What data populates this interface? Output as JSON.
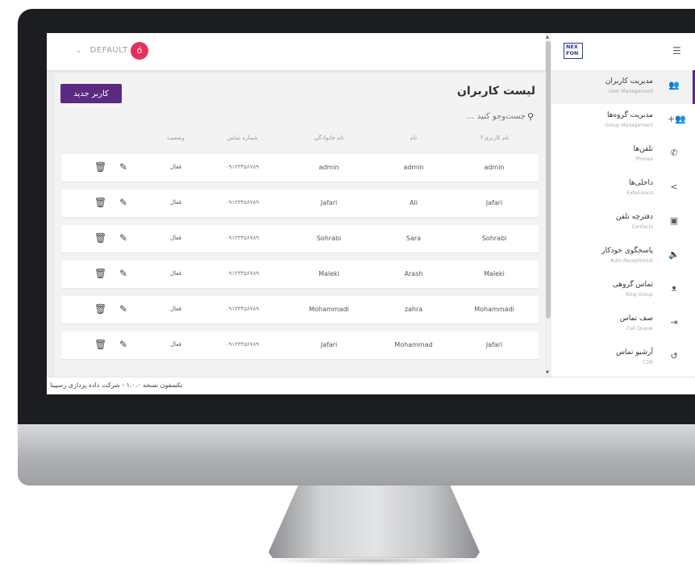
{
  "profile": {
    "label": "DEFAULT",
    "chevron": "chevron-down-icon"
  },
  "avatar": {
    "initial": "ó",
    "color": "#e5315a"
  },
  "header": {
    "title": "لیست کاربران",
    "new_user_label": "کاربر جدید"
  },
  "brand": {
    "logo_line1": "NEX",
    "logo_line2": "FON",
    "accent": "#5b2a82"
  },
  "search": {
    "placeholder": "جست‌وجو کنید ..."
  },
  "table": {
    "headers": {
      "username": "نام کاربری",
      "first_name": "نام",
      "last_name": "نام خانوادگی",
      "phone": "شماره تماس",
      "status": "وضعیت"
    },
    "rows": [
      {
        "username": "admin",
        "first_name": "admin",
        "last_name": "admin",
        "phone": "۰۹۱۲۳۴۵۶۷۸۹",
        "status": "فعال"
      },
      {
        "username": "Jafari",
        "first_name": "Ali",
        "last_name": "Jafari",
        "phone": "۰۹۱۲۳۴۵۶۷۸۹",
        "status": "فعال"
      },
      {
        "username": "Sohrabi",
        "first_name": "Sara",
        "last_name": "Sohrabi",
        "phone": "۰۹۱۲۳۴۵۶۷۸۹",
        "status": "فعال"
      },
      {
        "username": "Maleki",
        "first_name": "Arash",
        "last_name": "Maleki",
        "phone": "۰۹۱۲۳۴۵۶۷۸۹",
        "status": "فعال"
      },
      {
        "username": "Mohammadi",
        "first_name": "zahra",
        "last_name": "Mohammadi",
        "phone": "۰۹۱۲۳۴۵۶۷۸۹",
        "status": "فعال"
      },
      {
        "username": "Jafari",
        "first_name": "Mohammad",
        "last_name": "Jafari",
        "phone": "۰۹۱۲۳۴۵۶۷۸۹",
        "status": "فعال"
      }
    ]
  },
  "sidebar": {
    "items": [
      {
        "fa": "مدیریت کاربران",
        "en": "User Management",
        "icon": "users-icon"
      },
      {
        "fa": "مدیریت گروه‌ها",
        "en": "Group Management",
        "icon": "group-add-icon"
      },
      {
        "fa": "تلفن‌ها",
        "en": "Phones",
        "icon": "phone-icon"
      },
      {
        "fa": "داخلی‌ها",
        "en": "Extensions",
        "icon": "share-icon"
      },
      {
        "fa": "دفترچه تلفن",
        "en": "Contacts",
        "icon": "contacts-icon"
      },
      {
        "fa": "پاسخگوی خودکار",
        "en": "Auto Receptionist",
        "icon": "speaker-icon"
      },
      {
        "fa": "تماس گروهی",
        "en": "Ring Group",
        "icon": "ring-group-icon"
      },
      {
        "fa": "صف تماس",
        "en": "Call Queue",
        "icon": "queue-icon"
      },
      {
        "fa": "آرشیو تماس",
        "en": "CDR",
        "icon": "history-icon"
      }
    ]
  },
  "footer": {
    "text": "نکسفون نسخه ۱.۰.۰ - شرکت داده پردازی رسپینا"
  }
}
